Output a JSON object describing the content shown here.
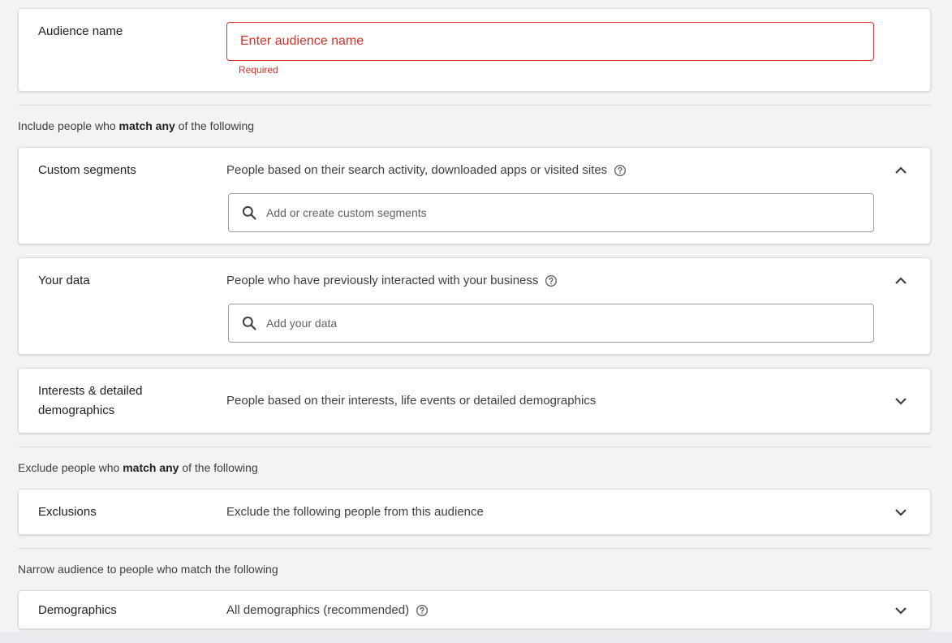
{
  "audience_name": {
    "label": "Audience name",
    "placeholder": "Enter audience name",
    "error": "Required"
  },
  "include": {
    "prefix": "Include people who ",
    "bold": "match any",
    "suffix": " of the following"
  },
  "custom_segments": {
    "title": "Custom segments",
    "description": "People based on their search activity, downloaded apps or visited sites",
    "search_placeholder": "Add or create custom segments"
  },
  "your_data": {
    "title": "Your data",
    "description": "People who have previously interacted with your business",
    "search_placeholder": "Add your data"
  },
  "interests": {
    "title_line1": "Interests & detailed",
    "title_line2": "demographics",
    "description": "People based on their interests, life events or detailed demographics"
  },
  "exclude": {
    "prefix": "Exclude people who ",
    "bold": "match any",
    "suffix": " of the following"
  },
  "exclusions": {
    "title": "Exclusions",
    "description": "Exclude the following people from this audience"
  },
  "narrow": {
    "label": "Narrow audience to people who match the following"
  },
  "demographics": {
    "title": "Demographics",
    "description": "All demographics (recommended)"
  },
  "colors": {
    "error": "#d93025",
    "border": "#dadce0",
    "background": "#f1f3f4"
  }
}
